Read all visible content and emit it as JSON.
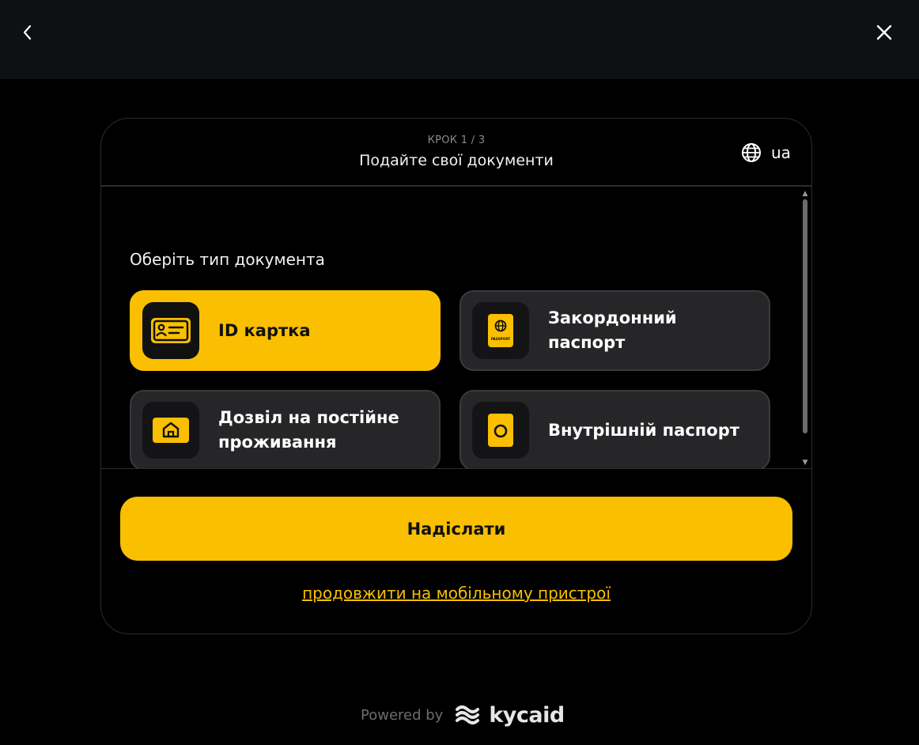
{
  "header": {
    "back_icon": "chevron-left-icon",
    "close_icon": "close-icon"
  },
  "card": {
    "step": "КРОК 1 / 3",
    "title": "Подайте свої документи",
    "language": {
      "icon": "globe-icon",
      "value": "ua"
    }
  },
  "document_select": {
    "label": "Оберіть тип документа",
    "options": [
      {
        "label": "ID картка",
        "icon": "id-card-icon",
        "selected": true
      },
      {
        "label": "Закордонний паспорт",
        "icon": "passport-icon",
        "selected": false
      },
      {
        "label": "Дозвіл на постійне проживання",
        "icon": "residence-permit-icon",
        "selected": false
      },
      {
        "label": "Внутрішній паспорт",
        "icon": "internal-passport-icon",
        "selected": false
      }
    ],
    "passport_icon_caption": "PASSPORT"
  },
  "actions": {
    "submit_label": "Надіслати",
    "mobile_link": "продовжити на мобільному пристрої"
  },
  "footer": {
    "powered_by": "Powered by",
    "brand": "kycaid"
  },
  "colors": {
    "accent": "#f9bf00",
    "background": "#000000",
    "topbar": "#0f1014",
    "tile": "#262628"
  }
}
